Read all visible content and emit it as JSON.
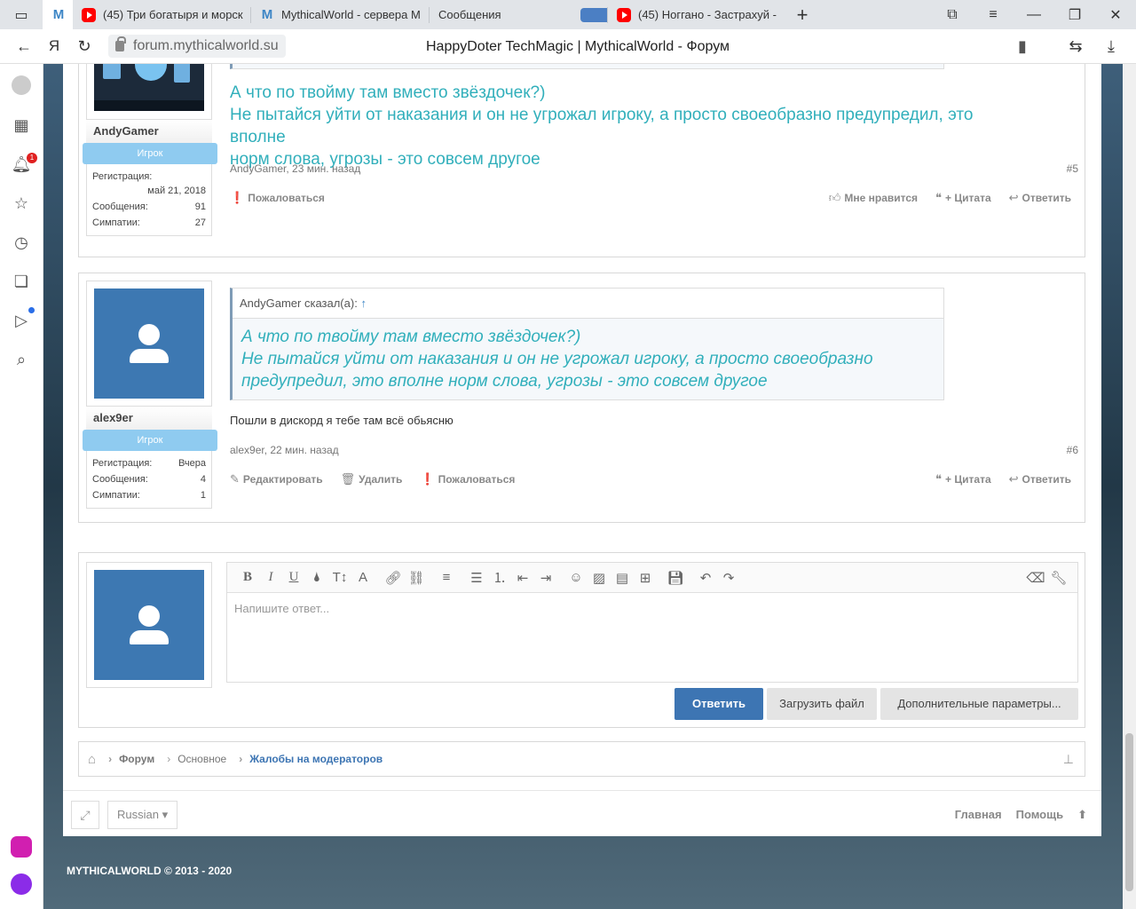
{
  "browser": {
    "tabs": [
      {
        "label": "",
        "icon": "sidebar-icon"
      },
      {
        "label": "",
        "icon": "m-favicon",
        "active": true
      },
      {
        "label": "(45) Три богатыря и морск",
        "icon": "youtube-favicon"
      },
      {
        "label": "MythicalWorld - сервера М",
        "icon": "m-favicon"
      },
      {
        "label": "Сообщения",
        "icon": "messages-favicon"
      },
      {
        "label": "(45) Ноггано - Застрахуй -",
        "icon": "youtube-favicon"
      }
    ],
    "url": "forum.mythicalworld.su",
    "page_title": "HappyDoter TechMagic | MythicalWorld - Форум",
    "yandex_letter": "Я",
    "notification_count": "1"
  },
  "post5": {
    "username": "AndyGamer",
    "role": "Игрок",
    "stats": [
      {
        "label": "Регистрация:",
        "value": "май 21, 2018"
      },
      {
        "label": "Сообщения:",
        "value": "91"
      },
      {
        "label": "Симпатии:",
        "value": "27"
      }
    ],
    "lines": [
      "А что по твойму там вместо звёздочек?)",
      "Не пытайся уйти от наказания и он не угрожал игроку, а просто своеобразно предупредил, это вполне",
      "норм слова, угрозы - это совсем другое"
    ],
    "meta": "AndyGamer, 23 мин. назад",
    "number": "#5",
    "report": "Пожаловаться",
    "like": "Мне нравится",
    "quote": "+ Цитата",
    "reply": "Ответить"
  },
  "post6": {
    "username": "alex9er",
    "role": "Игрок",
    "stats": [
      {
        "label": "Регистрация:",
        "value": "Вчера"
      },
      {
        "label": "Сообщения:",
        "value": "4"
      },
      {
        "label": "Симпатии:",
        "value": "1"
      }
    ],
    "quote_header": "AndyGamer сказал(а):",
    "quote_arrow": "↑",
    "quote_lines": [
      "А что по твойму там вместо звёздочек?)",
      "Не пытайся уйти от наказания и он не угрожал игроку, а просто своеобразно",
      "предупредил, это вполне норм слова, угрозы - это совсем другое"
    ],
    "text": "Пошли в дискорд я тебе там всё обьясню",
    "meta": "alex9er, 22 мин. назад",
    "number": "#6",
    "edit": "Редактировать",
    "delete": "Удалить",
    "report": "Пожаловаться",
    "quote": "+ Цитата",
    "reply": "Ответить"
  },
  "reply_box": {
    "placeholder": "Напишите ответ...",
    "submit": "Ответить",
    "upload": "Загрузить файл",
    "more": "Дополнительные параметры..."
  },
  "breadcrumb": [
    "Форум",
    "Основное",
    "Жалобы на модераторов"
  ],
  "footer": {
    "language": "Russian",
    "home": "Главная",
    "help": "Помощь",
    "copyright": "MYTHICALWORLD © 2013 - 2020"
  },
  "colors": {
    "accent": "#3d75b3",
    "quote_text": "#31afbb",
    "role_badge": "#8fcbf0"
  }
}
